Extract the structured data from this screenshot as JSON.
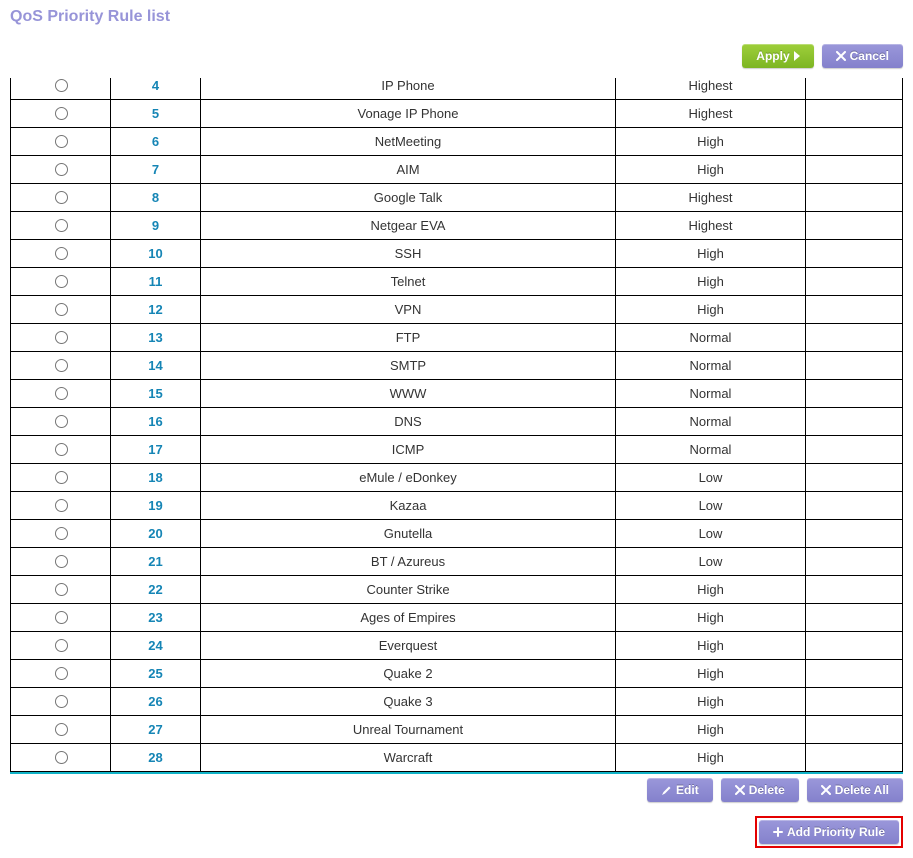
{
  "title": "QoS Priority Rule list",
  "buttons": {
    "apply": "Apply",
    "cancel": "Cancel",
    "edit": "Edit",
    "delete": "Delete",
    "delete_all": "Delete All",
    "add": "Add Priority Rule"
  },
  "rules": [
    {
      "num": "4",
      "name": "IP Phone",
      "priority": "Highest"
    },
    {
      "num": "5",
      "name": "Vonage IP Phone",
      "priority": "Highest"
    },
    {
      "num": "6",
      "name": "NetMeeting",
      "priority": "High"
    },
    {
      "num": "7",
      "name": "AIM",
      "priority": "High"
    },
    {
      "num": "8",
      "name": "Google Talk",
      "priority": "Highest"
    },
    {
      "num": "9",
      "name": "Netgear EVA",
      "priority": "Highest"
    },
    {
      "num": "10",
      "name": "SSH",
      "priority": "High"
    },
    {
      "num": "11",
      "name": "Telnet",
      "priority": "High"
    },
    {
      "num": "12",
      "name": "VPN",
      "priority": "High"
    },
    {
      "num": "13",
      "name": "FTP",
      "priority": "Normal"
    },
    {
      "num": "14",
      "name": "SMTP",
      "priority": "Normal"
    },
    {
      "num": "15",
      "name": "WWW",
      "priority": "Normal"
    },
    {
      "num": "16",
      "name": "DNS",
      "priority": "Normal"
    },
    {
      "num": "17",
      "name": "ICMP",
      "priority": "Normal"
    },
    {
      "num": "18",
      "name": "eMule / eDonkey",
      "priority": "Low"
    },
    {
      "num": "19",
      "name": "Kazaa",
      "priority": "Low"
    },
    {
      "num": "20",
      "name": "Gnutella",
      "priority": "Low"
    },
    {
      "num": "21",
      "name": "BT / Azureus",
      "priority": "Low"
    },
    {
      "num": "22",
      "name": "Counter Strike",
      "priority": "High"
    },
    {
      "num": "23",
      "name": "Ages of Empires",
      "priority": "High"
    },
    {
      "num": "24",
      "name": "Everquest",
      "priority": "High"
    },
    {
      "num": "25",
      "name": "Quake 2",
      "priority": "High"
    },
    {
      "num": "26",
      "name": "Quake 3",
      "priority": "High"
    },
    {
      "num": "27",
      "name": "Unreal Tournament",
      "priority": "High"
    },
    {
      "num": "28",
      "name": "Warcraft",
      "priority": "High"
    }
  ]
}
